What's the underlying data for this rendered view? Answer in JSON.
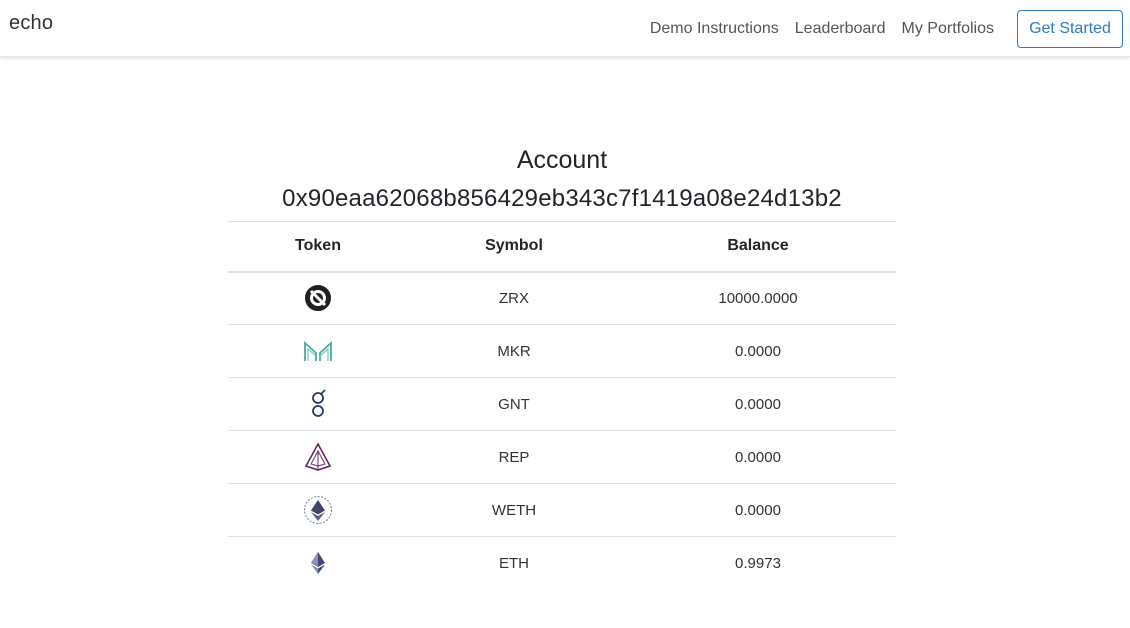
{
  "navbar": {
    "brand": "echo",
    "links": [
      "Demo Instructions",
      "Leaderboard",
      "My Portfolios"
    ],
    "cta_label": "Get Started",
    "accent": "#2e7bbf"
  },
  "account": {
    "title": "Account",
    "address": "0x90eaa62068b856429eb343c7f1419a08e24d13b2"
  },
  "table": {
    "headers": {
      "token": "Token",
      "symbol": "Symbol",
      "balance": "Balance"
    },
    "rows": [
      {
        "icon": "zrx-icon",
        "symbol": "ZRX",
        "balance": "10000.0000"
      },
      {
        "icon": "mkr-icon",
        "symbol": "MKR",
        "balance": "0.0000"
      },
      {
        "icon": "gnt-icon",
        "symbol": "GNT",
        "balance": "0.0000"
      },
      {
        "icon": "rep-icon",
        "symbol": "REP",
        "balance": "0.0000"
      },
      {
        "icon": "weth-icon",
        "symbol": "WETH",
        "balance": "0.0000"
      },
      {
        "icon": "eth-icon",
        "symbol": "ETH",
        "balance": "0.9973"
      }
    ]
  }
}
